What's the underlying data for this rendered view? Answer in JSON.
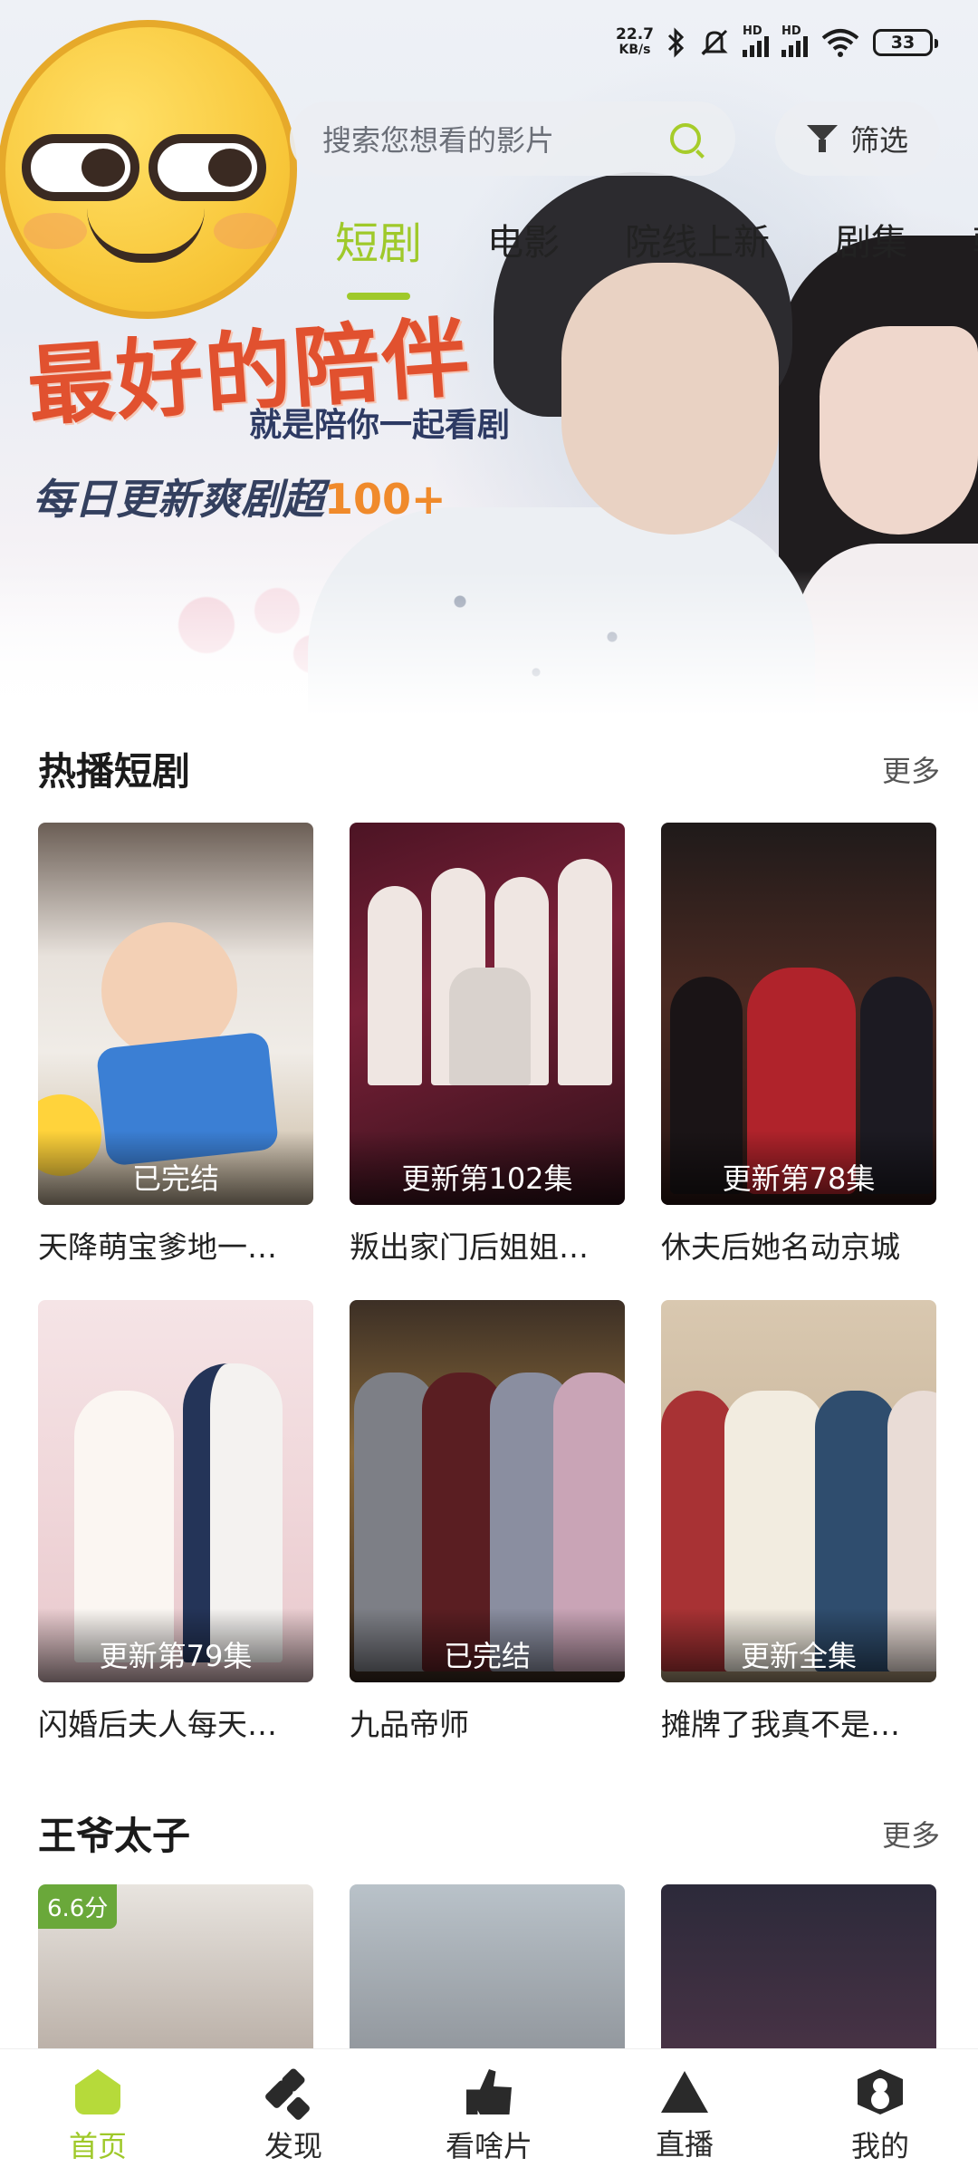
{
  "status_bar": {
    "speed_value": "22.7",
    "speed_unit": "KB/s",
    "sim1_label": "HD",
    "sim2_label": "HD",
    "battery": "33"
  },
  "search": {
    "placeholder": "搜索您想看的影片",
    "filter_label": "筛选"
  },
  "tabs": [
    {
      "label": "短剧",
      "active": true
    },
    {
      "label": "电影"
    },
    {
      "label": "院线上新"
    },
    {
      "label": "剧集"
    },
    {
      "label": "韩"
    }
  ],
  "banner": {
    "headline": "最好的陪伴",
    "subline": "就是陪你一起看剧",
    "daily_text": "每日更新爽剧超",
    "daily_count": "100+"
  },
  "hot_section": {
    "title": "热播短剧",
    "more": "更多",
    "items": [
      {
        "title": "天降萌宝爹地一…",
        "badge": "已完结"
      },
      {
        "title": "叛出家门后姐姐…",
        "badge": "更新第102集"
      },
      {
        "title": "休夫后她名动京城",
        "badge": "更新第78集"
      },
      {
        "title": "闪婚后夫人每天…",
        "badge": "更新第79集"
      },
      {
        "title": "九品帝师",
        "badge": "已完结"
      },
      {
        "title": "摊牌了我真不是…",
        "badge": "更新全集"
      }
    ]
  },
  "prince_section": {
    "title": "王爷太子",
    "more": "更多",
    "items": [
      {
        "score": "6.6分"
      },
      {},
      {}
    ]
  },
  "bottom_nav": [
    {
      "label": "首页",
      "icon": "home-icon",
      "active": true
    },
    {
      "label": "发现",
      "icon": "discover-icon"
    },
    {
      "label": "看啥片",
      "icon": "thumb-up-icon"
    },
    {
      "label": "直播",
      "icon": "live-icon"
    },
    {
      "label": "我的",
      "icon": "profile-icon"
    }
  ],
  "colors": {
    "accent": "#9fc92a",
    "promo_red": "#e1512f",
    "promo_orange": "#f08a2b"
  }
}
